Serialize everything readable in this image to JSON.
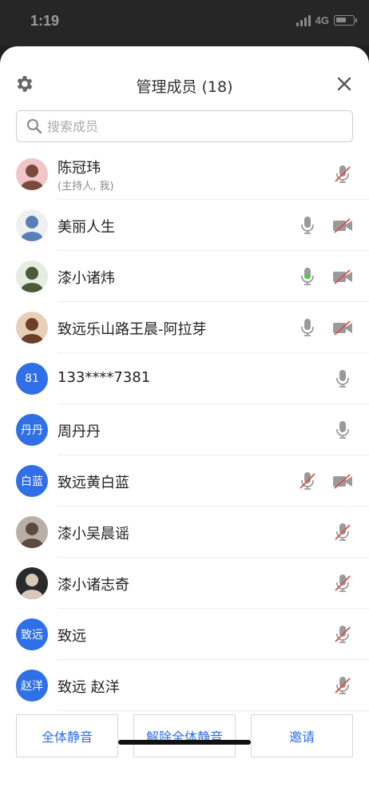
{
  "status_bar": {
    "time": "1:19",
    "network": "4G"
  },
  "header": {
    "title": "管理成员 (18)"
  },
  "search": {
    "placeholder": "搜索成员",
    "value": ""
  },
  "members": [
    {
      "name": "陈冠玮",
      "sub": "(主持人, 我)",
      "avatar_type": "photo",
      "mic": "muted",
      "camera": "none"
    },
    {
      "name": "美丽人生",
      "avatar_type": "photo",
      "mic": "on",
      "camera": "off"
    },
    {
      "name": "漆小诸炜",
      "avatar_type": "photo",
      "mic": "speaking",
      "camera": "off"
    },
    {
      "name": "致远乐山路王晨-阿拉芽",
      "avatar_type": "photo",
      "mic": "on",
      "camera": "off"
    },
    {
      "name": "133****7381",
      "avatar_type": "text",
      "avatar_text": "81",
      "mic": "on",
      "camera": "none"
    },
    {
      "name": "周丹丹",
      "avatar_type": "text",
      "avatar_text": "丹丹",
      "mic": "on",
      "camera": "none"
    },
    {
      "name": "致远黄白蓝",
      "avatar_type": "text",
      "avatar_text": "白蓝",
      "mic": "muted",
      "camera": "off"
    },
    {
      "name": "漆小吴晨谣",
      "avatar_type": "photo",
      "mic": "muted",
      "camera": "none"
    },
    {
      "name": "漆小诸志奇",
      "avatar_type": "photo",
      "mic": "muted",
      "camera": "none"
    },
    {
      "name": "致远",
      "avatar_type": "text",
      "avatar_text": "致远",
      "mic": "muted",
      "camera": "none"
    },
    {
      "name": "致远 赵洋",
      "avatar_type": "text",
      "avatar_text": "赵洋",
      "mic": "muted",
      "camera": "none"
    }
  ],
  "footer": {
    "mute_all": "全体静音",
    "unmute_all": "解除全体静音",
    "invite": "邀请"
  },
  "colors": {
    "accent": "#2f6fe8",
    "muted": "#e04a4a",
    "speaking": "#5cc35c",
    "icon": "#9a9a9a"
  }
}
